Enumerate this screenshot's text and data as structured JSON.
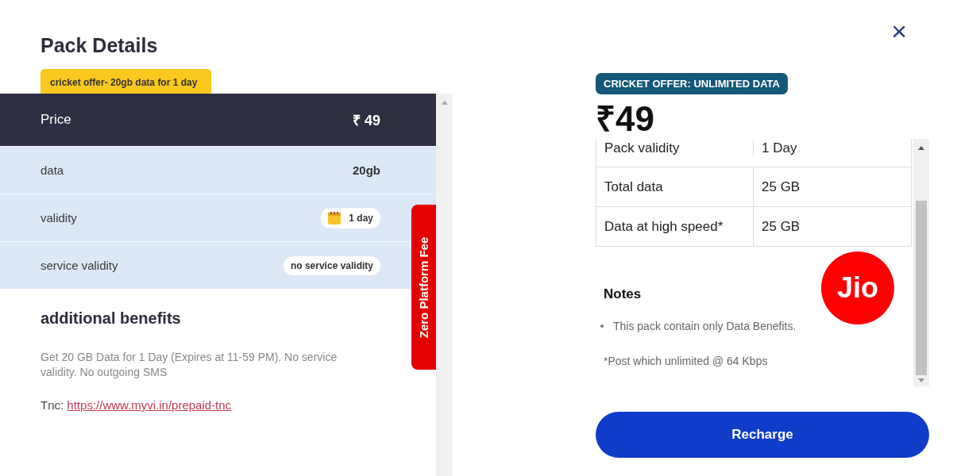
{
  "left_panel": {
    "title": "Pack Details",
    "offer_tag": "cricket offer- 20gb data for 1 day",
    "price": {
      "label": "Price",
      "value": "₹ 49"
    },
    "rows": [
      {
        "kind": "plain",
        "label": "data",
        "value": "20gb"
      },
      {
        "kind": "calendar_chip",
        "label": "validity",
        "value": "1 day"
      },
      {
        "kind": "chip",
        "label": "service validity",
        "value": "no service validity"
      }
    ],
    "side_tab": "Zero Platform Fee",
    "benefits_heading": "additional benefits",
    "benefits_text": "Get 20 GB Data for 1 Day (Expires at 11-59 PM). No service validity. No outgoing SMS",
    "tnc_label": "Tnc:",
    "tnc_link": "https://www.myvi.in/prepaid-tnc"
  },
  "right_panel": {
    "close": "×",
    "offer_tag": "CRICKET OFFER: UNLIMITED DATA",
    "price": "₹49",
    "table": [
      {
        "label": "Pack validity",
        "value": "1 Day"
      },
      {
        "label": "Total data",
        "value": "25 GB"
      },
      {
        "label": "Data at high speed*",
        "value": "25 GB"
      }
    ],
    "notes_heading": "Notes",
    "notes": [
      "This pack contain only Data Benefits."
    ],
    "footnote": "*Post which unlimited @ 64 Kbps",
    "logo": "Jio",
    "button": "Recharge"
  }
}
